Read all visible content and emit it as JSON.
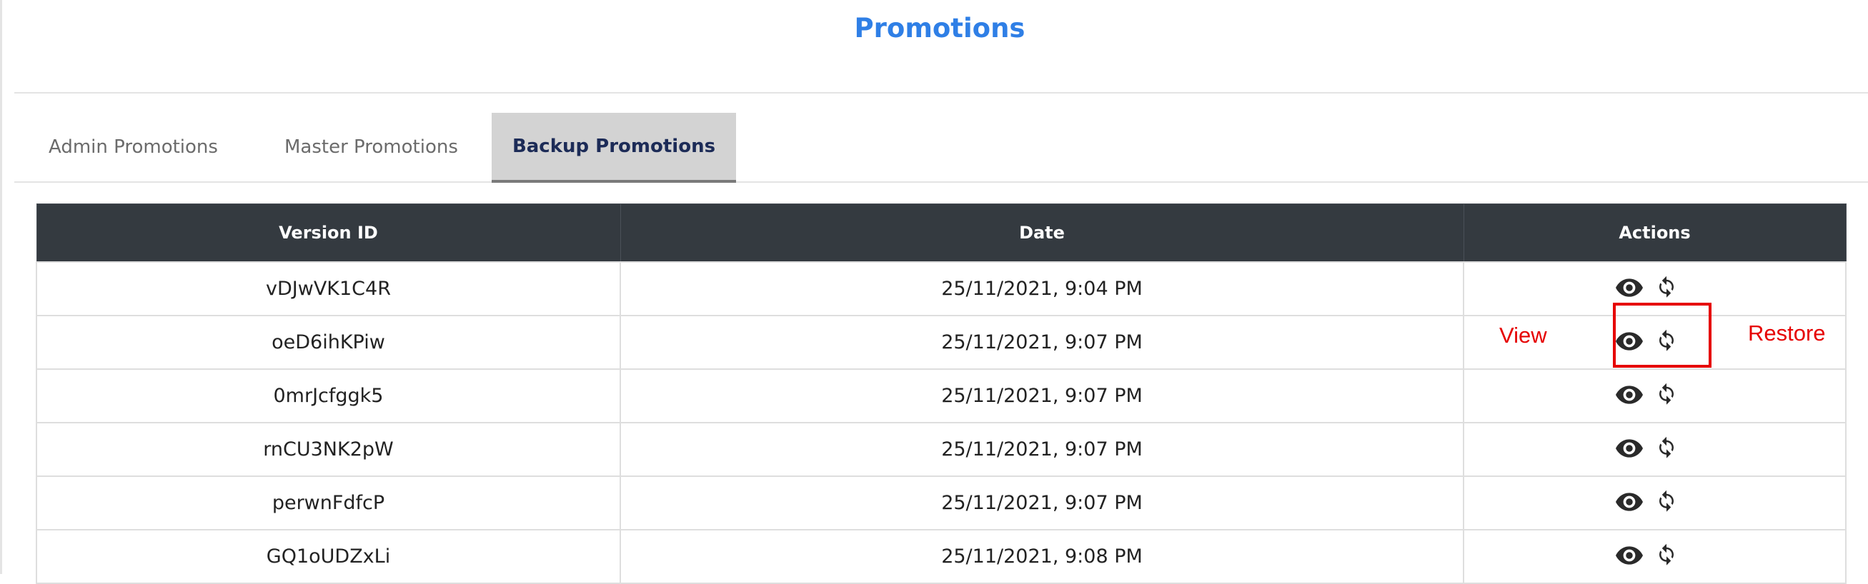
{
  "page": {
    "title": "Promotions"
  },
  "tabs": [
    {
      "label": "Admin Promotions",
      "active": false
    },
    {
      "label": "Master Promotions",
      "active": false
    },
    {
      "label": "Backup Promotions",
      "active": true
    }
  ],
  "table": {
    "columns": [
      "Version ID",
      "Date",
      "Actions"
    ],
    "rows": [
      {
        "version_id": "vDJwVK1C4R",
        "date": "25/11/2021, 9:04 PM"
      },
      {
        "version_id": "oeD6ihKPiw",
        "date": "25/11/2021, 9:07 PM"
      },
      {
        "version_id": "0mrJcfggk5",
        "date": "25/11/2021, 9:07 PM"
      },
      {
        "version_id": "rnCU3NK2pW",
        "date": "25/11/2021, 9:07 PM"
      },
      {
        "version_id": "perwnFdfcP",
        "date": "25/11/2021, 9:07 PM"
      },
      {
        "version_id": "GQ1oUDZxLi",
        "date": "25/11/2021, 9:08 PM"
      }
    ],
    "row_actions": [
      "eye-icon",
      "refresh-icon"
    ]
  },
  "annotations": {
    "view_label": "View",
    "restore_label": "Restore",
    "highlight_color": "#e60000"
  },
  "colors": {
    "title": "#2f7fe6",
    "header_bg": "#343a40",
    "active_tab_bg": "#d3d3d3",
    "active_tab_text": "#1c2b57"
  }
}
